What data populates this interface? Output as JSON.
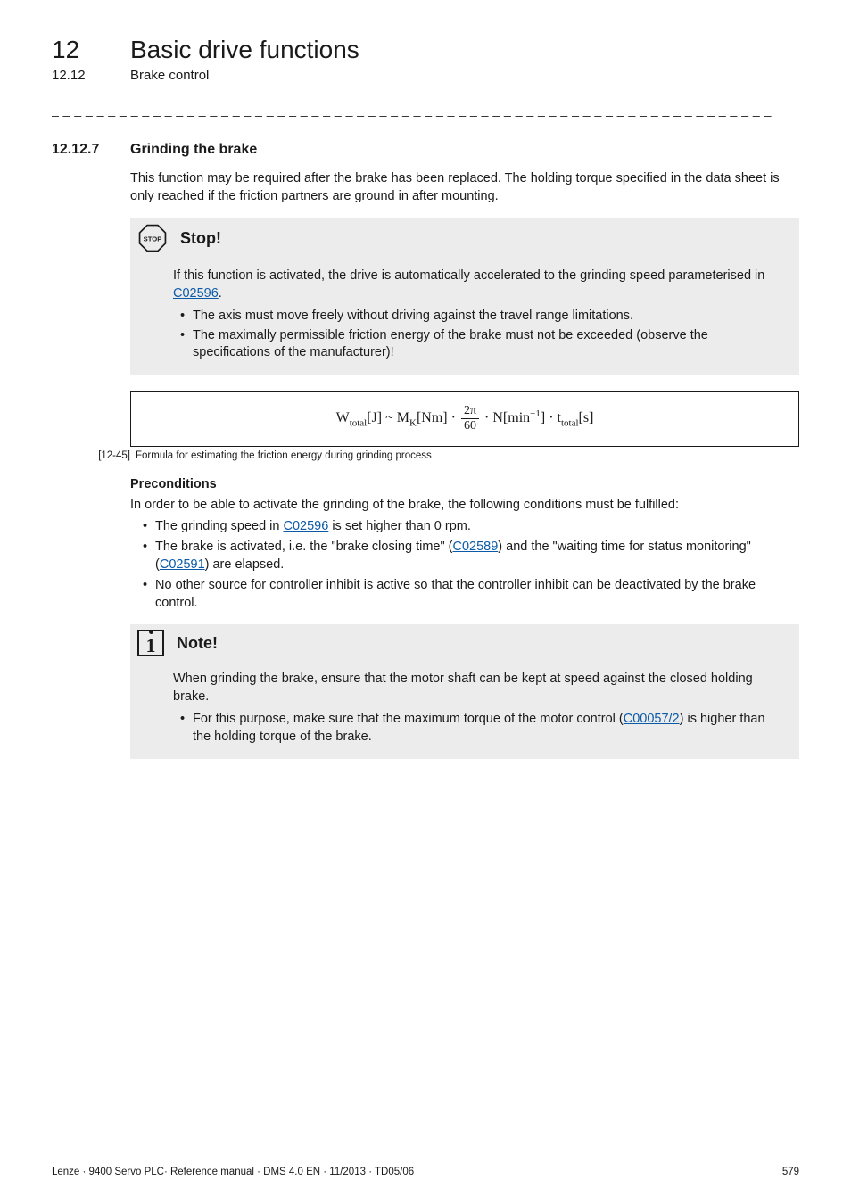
{
  "header": {
    "chapter_num": "12",
    "chapter_title": "Basic drive functions",
    "sub_num": "12.12",
    "sub_title": "Brake control"
  },
  "dash_rule": "_ _ _ _ _ _ _ _ _ _ _ _ _ _ _ _ _ _ _ _ _ _ _ _ _ _ _ _ _ _ _ _ _ _ _ _ _ _ _ _ _ _ _ _ _ _ _ _ _ _ _ _ _ _ _ _ _ _ _ _ _ _ _ _",
  "section": {
    "num": "12.12.7",
    "title": "Grinding the brake",
    "intro": "This function may be required after the brake has been replaced. The holding torque specified in the data sheet is only reached if the friction partners are ground in after mounting."
  },
  "stop": {
    "title": "Stop!",
    "glyph": "STOP",
    "body_lead1": "If this function is activated, the drive is automatically accelerated to the grinding speed parameterised in ",
    "link1": "C02596",
    "body_lead2": ".",
    "items": [
      "The axis must move freely without driving against the travel range limitations.",
      "The maximally permissible friction energy of the brake must not be exceeded (observe the specifications of the manufacturer)!"
    ]
  },
  "formula_caption": {
    "tag": "[12-45]",
    "text": "Formula for estimating the friction energy during grinding process"
  },
  "preconditions": {
    "heading": "Preconditions",
    "lead": "In order to be able to activate the grinding of the brake, the following conditions must be fulfilled:",
    "item1_a": "The grinding speed in ",
    "item1_link": "C02596",
    "item1_b": " is set higher than 0 rpm.",
    "item2_a": "The brake is activated, i.e. the \"brake closing time\" (",
    "item2_link1": "C02589",
    "item2_b": ") and the \"waiting time for status monitoring\" (",
    "item2_link2": "C02591",
    "item2_c": ") are elapsed.",
    "item3": "No other source for controller inhibit is active so that the controller inhibit can be deactivated by the brake control."
  },
  "note": {
    "title": "Note!",
    "body": "When grinding the brake, ensure that the motor shaft can be kept at speed against the closed holding brake.",
    "item_a": "For this purpose, make sure that the maximum torque of the motor control (",
    "item_link": "C00057/2",
    "item_b": ") is higher than the holding torque of the brake."
  },
  "footer": {
    "left": "Lenze · 9400 Servo PLC· Reference manual · DMS 4.0 EN · 11/2013 · TD05/06",
    "right": "579"
  }
}
